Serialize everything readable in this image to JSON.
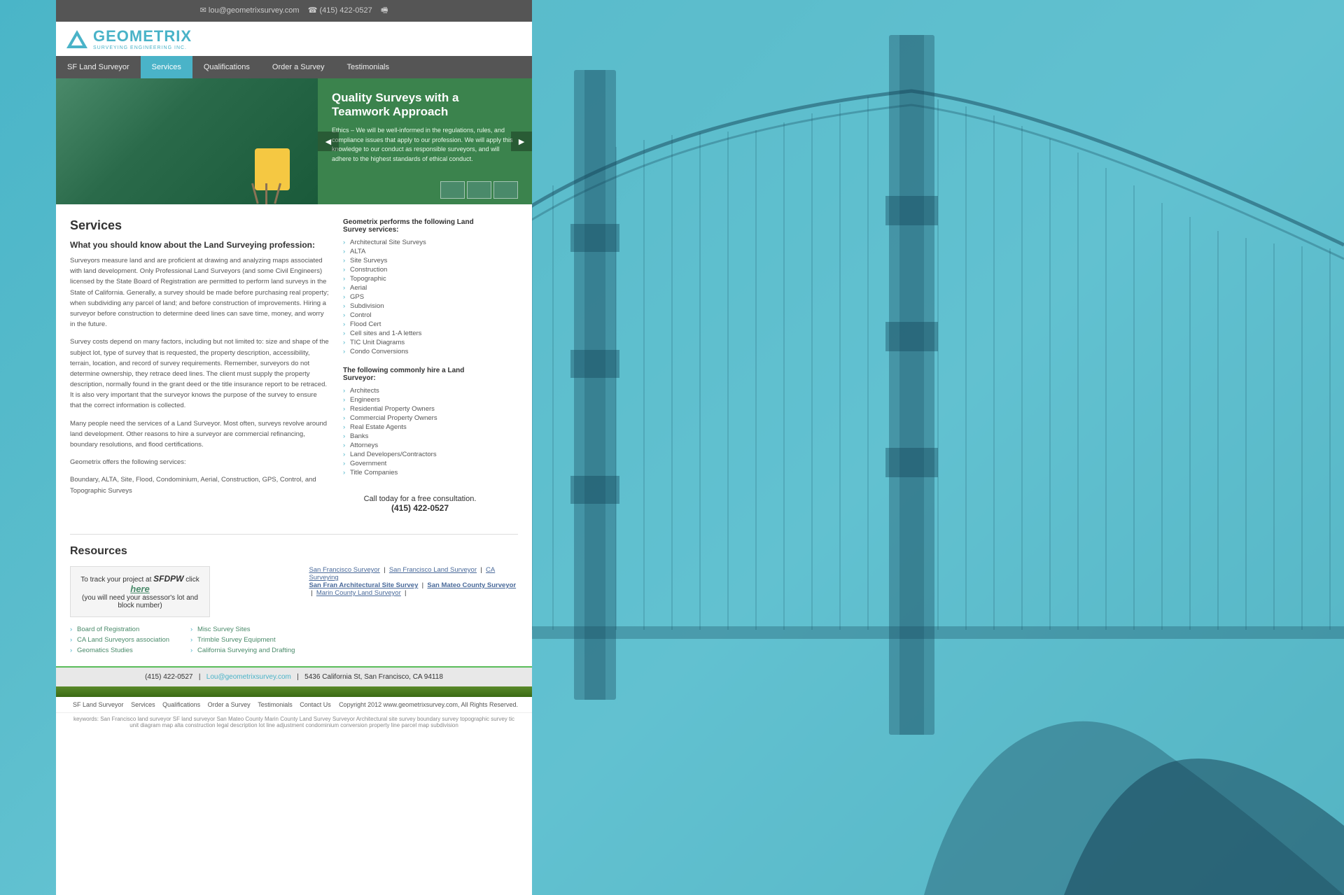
{
  "site": {
    "title": "Geometrix Surveying Engineering Inc.",
    "email": "lou@geometrixsurvey.com",
    "phone": "(415) 422-0527",
    "address": "5436 California St, San Francisco, CA 94118"
  },
  "topbar": {
    "email": "lou@geometrixsurvey.com",
    "phone": "(415) 422-0527",
    "fax_icon": "fax-icon"
  },
  "nav": {
    "items": [
      {
        "label": "SF Land Surveyor",
        "active": false
      },
      {
        "label": "Services",
        "active": true
      },
      {
        "label": "Qualifications",
        "active": false
      },
      {
        "label": "Order a Survey",
        "active": false
      },
      {
        "label": "Testimonials",
        "active": false
      }
    ]
  },
  "hero": {
    "title": "Quality Surveys with a Teamwork Approach",
    "description": "Ethics – We will be well-informed in the regulations, rules, and compliance issues that apply to our profession. We will apply this knowledge to our conduct as responsible surveyors, and will adhere to the highest standards of ethical conduct.",
    "prev_arrow": "◄",
    "next_arrow": "►"
  },
  "services": {
    "page_title": "Services",
    "subtitle": "What you should know about the Land Surveying profession:",
    "intro_p1": "Surveyors measure land and are proficient at drawing and analyzing maps associated with land development. Only Professional Land Surveyors (and some Civil Engineers) licensed by the State Board of Registration are permitted to perform land surveys in the State of California. Generally, a survey should be made before purchasing real property; when subdividing any parcel of land; and before construction of improvements. Hiring a surveyor before construction to determine deed lines can save time, money, and worry in the future.",
    "intro_p2": "Survey costs depend on many factors, including but not limited to: size and shape of the subject lot, type of survey that is requested, the property description, accessibility, terrain, location, and record of survey requirements. Remember, surveyors do not determine ownership, they retrace deed lines. The client must supply the property description, normally found in the grant deed or the title insurance report to be retraced. It is also very important that the surveyor knows the purpose of the survey to ensure that the correct information is collected.",
    "intro_p3": "Many people need the services of a Land Surveyor. Most often, surveys revolve around land development. Other reasons to hire a surveyor are commercial refinancing, boundary resolutions, and flood certifications.",
    "intro_p4": "Geometrix offers the following services:",
    "services_list": "Boundary, ALTA, Site, Flood, Condominium, Aerial, Construction, GPS, Control, and Topographic Surveys",
    "right_header": "Geometrix performs the following Land Survey services:",
    "survey_types": [
      "Architectural Site Surveys",
      "ALTA",
      "Site Surveys",
      "Construction",
      "Topographic",
      "Aerial",
      "GPS",
      "Subdivision",
      "Control",
      "Flood Cert",
      "Cell sites and 1-A letters",
      "TIC Unit Diagrams",
      "Condo Conversions"
    ],
    "hire_header": "The following commonly hire a Land Surveyor:",
    "hire_list": [
      "Architects",
      "Engineers",
      "Residential Property Owners",
      "Commercial Property Owners",
      "Real Estate Agents",
      "Banks",
      "Attorneys",
      "Land Developers/Contractors",
      "Government",
      "Title Companies"
    ],
    "call_text": "Call today for a free consultation.",
    "call_phone": "(415) 422-0527"
  },
  "resources": {
    "title": "Resources",
    "track_label1": "To track your project at",
    "track_sfdpw": "SFDPW",
    "track_label2": "click",
    "track_here": "here",
    "track_sub": "(you will need your assessor's lot and block number)",
    "links_left": [
      {
        "label": "Board of Registration",
        "href": "#"
      },
      {
        "label": "CA Land Surveyors association",
        "href": "#"
      },
      {
        "label": "Geomatics Studies",
        "href": "#"
      }
    ],
    "links_right": [
      {
        "label": "Misc Survey Sites",
        "href": "#"
      },
      {
        "label": "Trimble Survey Equipment",
        "href": "#"
      },
      {
        "label": "California Surveying and Drafting",
        "href": "#"
      }
    ],
    "ext_links": [
      {
        "label": "San Francisco Surveyor",
        "href": "#"
      },
      {
        "label": "San Francisco Land Surveyor",
        "href": "#"
      },
      {
        "label": "CA Surveying",
        "href": "#"
      },
      {
        "label": "San Fran Architectural Site Survey",
        "href": "#"
      },
      {
        "label": "San Mateo County Surveyor",
        "href": "#"
      },
      {
        "label": "Marin County Land Surveyor",
        "href": "#"
      }
    ]
  },
  "footer": {
    "phone": "(415) 422-0527",
    "email": "Lou@geometrixsurvey.com",
    "address": "5436 California St, San Francisco, CA 94118",
    "copyright": "Copyright 2012 www.geometrixsurvey.com, All Rights Reserved.",
    "bottom_nav": [
      "SF Land Surveyor",
      "Services",
      "Qualifications",
      "Order a Survey",
      "Testimonials",
      "Contact Us"
    ],
    "keywords": "keywords: San Francisco land surveyor SF land surveyor San Mateo County Marin County Land Survey Surveyor Architectural site survey boundary survey topographic survey tic unit diagram map alta construction legal description lot line adjustment condominium conversion property line parcel map subdivision"
  }
}
